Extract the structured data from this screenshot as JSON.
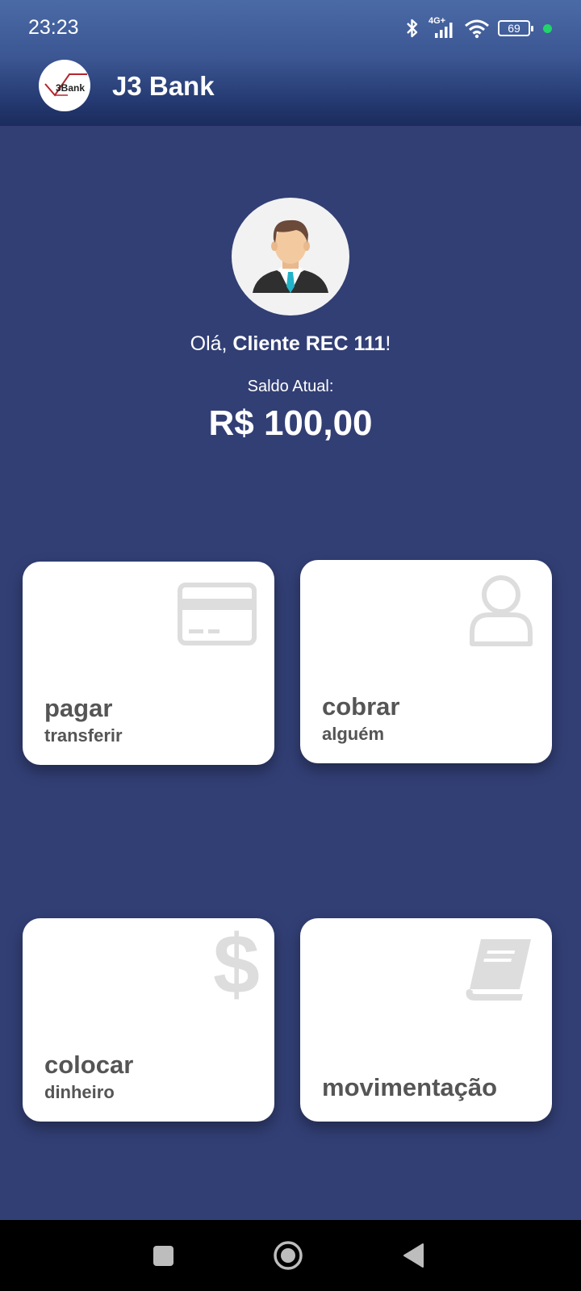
{
  "status_bar": {
    "time": "23:23",
    "network": "4G+",
    "battery": "69",
    "icons": [
      "bluetooth-icon",
      "signal-icon",
      "wifi-icon",
      "battery-icon"
    ]
  },
  "app_bar": {
    "title": "J3 Bank",
    "logo_text": "3Bank"
  },
  "profile": {
    "greeting_prefix": "Olá, ",
    "name": "Cliente REC 111",
    "greeting_suffix": "!",
    "balance_label": "Saldo Atual:",
    "balance": "R$ 100,00"
  },
  "actions": [
    {
      "title": "pagar",
      "subtitle": "transferir",
      "icon": "credit-card-icon"
    },
    {
      "title": "cobrar",
      "subtitle": "alguém",
      "icon": "user-icon"
    },
    {
      "title": "colocar",
      "subtitle": "dinheiro",
      "icon": "dollar-icon"
    },
    {
      "title": "movimentação",
      "subtitle": "",
      "icon": "book-icon"
    }
  ],
  "colors": {
    "background": "#323f75",
    "card": "#ffffff",
    "card_text": "#555555",
    "icon_gray": "#dddddd",
    "status_dot": "#21d46b"
  },
  "nav_bar": {
    "buttons": [
      "recents-button",
      "home-button",
      "back-button"
    ]
  }
}
